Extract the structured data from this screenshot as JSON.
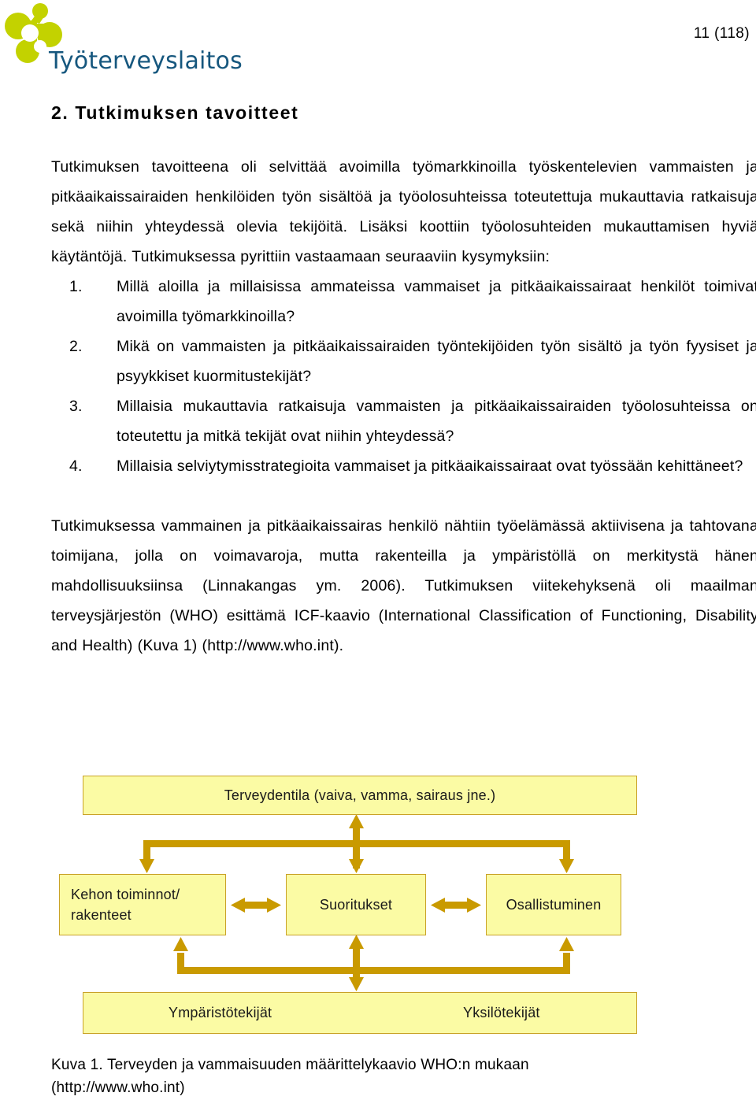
{
  "header": {
    "logo_word": "Työterveyslaitos",
    "logo_icon": "molecule-logo-icon",
    "page_number": "11 (118)",
    "logo_green": "#c3d200",
    "logo_blue": "#16577e"
  },
  "section": {
    "title": "2. Tutkimuksen tavoitteet",
    "intro": "Tutkimuksen tavoitteena oli selvittää avoimilla työmarkkinoilla työskentelevien vammaisten ja pitkäaikaissairaiden henkilöiden työn sisältöä ja työolosuhteissa toteutettuja mukauttavia ratkaisuja sekä niihin yhteydessä olevia tekijöitä. Lisäksi koottiin työolosuhteiden mukauttamisen hyviä käytäntöjä. Tutkimuksessa pyrittiin vastaamaan seuraaviin kysymyksiin:",
    "questions": [
      {
        "num": "1.",
        "text": "Millä aloilla ja millaisissa ammateissa vammaiset ja pitkäaikaissairaat henkilöt toimivat avoimilla työmarkkinoilla?"
      },
      {
        "num": "2.",
        "text": "Mikä on vammaisten ja pitkäaikaissairaiden työntekijöiden työn sisältö ja työn fyysiset ja psyykkiset kuormitustekijät?"
      },
      {
        "num": "3.",
        "text": "Millaisia mukauttavia ratkaisuja vammaisten ja pitkäaikaissairaiden työolosuhteissa on toteutettu ja mitkä tekijät ovat niihin yhteydessä?"
      },
      {
        "num": "4.",
        "text": "Millaisia selviytymisstrategioita vammaiset ja pitkäaikaissairaat ovat työssään kehittäneet?"
      }
    ],
    "framework": "Tutkimuksessa vammainen ja pitkäaikaissairas henkilö nähtiin työelämässä aktiivisena ja tahtovana toimijana, jolla on voimavaroja, mutta rakenteilla ja ympäristöllä on merkitystä hänen mahdollisuuksiinsa (Linnakangas ym. 2006). Tutkimuksen viitekehyksenä oli maailman terveysjärjestön (WHO) esittämä ICF-kaavio (International Classification of Functioning, Disability and Health) (Kuva 1) (http://www.who.int)."
  },
  "figure": {
    "box_fill": "#fbfba4",
    "box_border": "#c9a227",
    "arrow_color": "#c99a00",
    "boxes": {
      "top": "Terveydentila (vaiva, vamma, sairaus jne.)",
      "left": "Kehon toiminnot/",
      "left_line2": "rakenteet",
      "middle": "Suoritukset",
      "right": "Osallistuminen",
      "bottom_env": "Ympäristötekijät",
      "bottom_ind": "Yksilötekijät"
    },
    "caption_line1": "Kuva 1. Terveyden ja vammaisuuden määrittelykaavio WHO:n mukaan",
    "caption_line2": "(http://www.who.int)"
  }
}
